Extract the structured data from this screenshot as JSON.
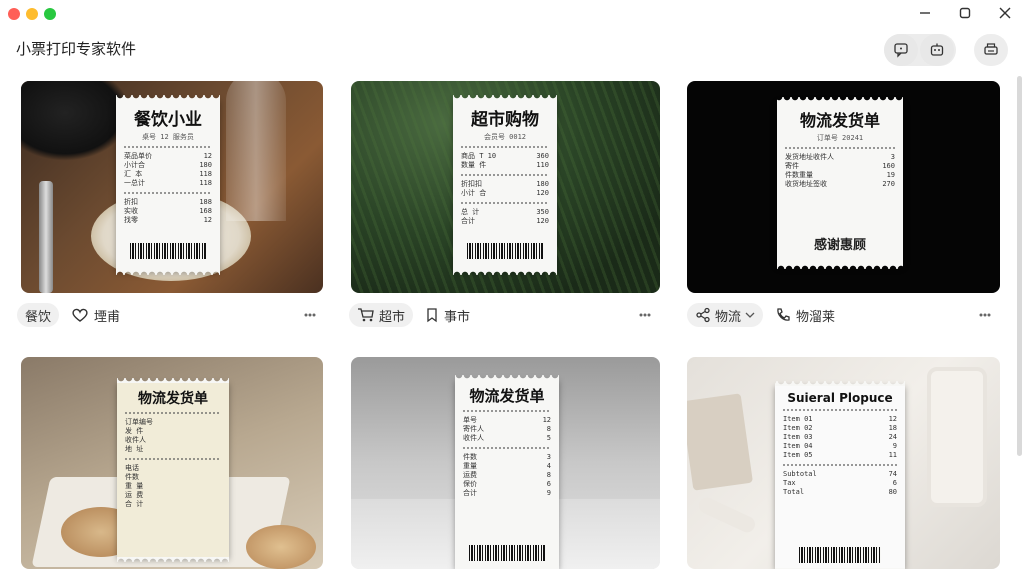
{
  "app": {
    "title": "小票打印专家软件"
  },
  "window_controls": {
    "minimize": "—",
    "maximize": "□",
    "close": "✕"
  },
  "toolbar": {
    "buttons": [
      {
        "icon": "chat-bubble-icon"
      },
      {
        "icon": "robot-assistant-icon"
      },
      {
        "icon": "printer-icon"
      }
    ]
  },
  "cards": [
    {
      "receipt_title": "餐饮小业",
      "receipt_sub": "桌号 12 服务员",
      "tag1": "餐饮",
      "tag2": "堙甫",
      "tag1_icon": "none",
      "tag2_icon": "heart-icon",
      "lines": [
        [
          "菜品单价",
          "12"
        ],
        [
          "小计合",
          "180"
        ],
        [
          "汇 本",
          "118"
        ],
        [
          "一总计",
          "118"
        ],
        [
          "折扣",
          "188"
        ],
        [
          "实收",
          "168"
        ],
        [
          "找零",
          "12"
        ]
      ]
    },
    {
      "receipt_title": "超市购物",
      "receipt_sub": "会员号 0012",
      "tag1": "超市",
      "tag2": "事市",
      "tag1_icon": "cart-icon",
      "tag2_icon": "bookmark-icon",
      "lines": [
        [
          "商品 T 10",
          "360"
        ],
        [
          "数量 件",
          "110"
        ],
        [
          "折扣扣",
          "180"
        ],
        [
          "小计 合",
          "120"
        ],
        [
          "总 计",
          "350"
        ],
        [
          "合计",
          "120"
        ]
      ]
    },
    {
      "receipt_title": "物流发货单",
      "receipt_sub": "订单号 20241",
      "tag1": "物流",
      "tag2": "物溜莱",
      "tag1_icon": "share-icon",
      "tag2_icon": "phone-icon",
      "lines": [
        [
          "发货地址收件人",
          "3"
        ],
        [
          "寄件",
          "160"
        ],
        [
          "件数重量",
          "19"
        ],
        [
          "收货地址签收",
          "270"
        ]
      ],
      "foot": "感谢惠顾"
    },
    {
      "receipt_title": "物流发货单",
      "receipt_sub": "",
      "lines": [
        [
          "订单编号",
          ""
        ],
        [
          "发 件",
          ""
        ],
        [
          "收件人",
          ""
        ],
        [
          "地 址",
          ""
        ],
        [
          "电话",
          ""
        ],
        [
          "件数",
          ""
        ],
        [
          "重 量",
          ""
        ],
        [
          "运 费",
          ""
        ],
        [
          "合 计",
          ""
        ]
      ]
    },
    {
      "receipt_title": "物流发货单",
      "receipt_sub": "",
      "lines": [
        [
          "单号",
          "12"
        ],
        [
          "寄件人",
          "8"
        ],
        [
          "收件人",
          "5"
        ],
        [
          "件数",
          "3"
        ],
        [
          "重量",
          "4"
        ],
        [
          "运费",
          "8"
        ],
        [
          "保价",
          "6"
        ],
        [
          "合计",
          "9"
        ]
      ]
    },
    {
      "receipt_title": "Suieral Plopuce",
      "receipt_sub": "",
      "lines": [
        [
          "Item 01",
          "12"
        ],
        [
          "Item 02",
          "18"
        ],
        [
          "Item 03",
          "24"
        ],
        [
          "Item 04",
          "9"
        ],
        [
          "Item 05",
          "11"
        ],
        [
          "Subtotal",
          "74"
        ],
        [
          "Tax",
          "6"
        ],
        [
          "Total",
          "80"
        ]
      ]
    }
  ]
}
